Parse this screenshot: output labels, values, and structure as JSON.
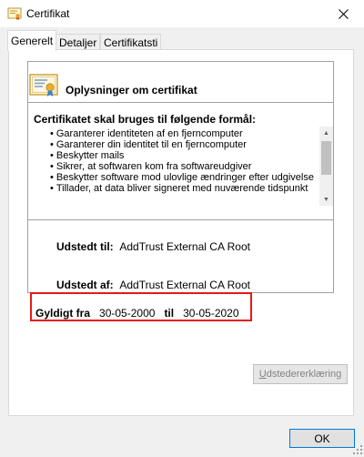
{
  "window": {
    "title": "Certifikat"
  },
  "tabs": [
    {
      "label": "Generelt",
      "active": true
    },
    {
      "label": "Detaljer",
      "active": false
    },
    {
      "label": "Certifikatsti",
      "active": false
    }
  ],
  "general": {
    "box_title": "Oplysninger om certifikat",
    "purpose_title": "Certifikatet skal bruges til følgende formål:",
    "purposes": [
      "Garanterer identiteten af en fjerncomputer",
      "Garanterer din identitet til en fjerncomputer",
      "Beskytter mails",
      "Sikrer, at softwaren kom fra softwareudgiver",
      "Beskytter software mod ulovlige ændringer efter udgivelse",
      "Tillader, at data bliver signeret med nuværende tidspunkt"
    ],
    "issued_to_label": "Udstedt til:",
    "issued_to_value": "AddTrust External CA Root",
    "issued_by_label": "Udstedt af:",
    "issued_by_value": "AddTrust External CA Root",
    "valid_from_label": "Gyldigt fra",
    "valid_from_value": "30-05-2000",
    "valid_to_label": "til",
    "valid_to_value": "30-05-2020",
    "issuer_statement_first": "U",
    "issuer_statement_rest": "dstedererklæring"
  },
  "footer": {
    "ok_label": "OK"
  },
  "colors": {
    "highlight_border": "#e51919",
    "focus_border": "#0078d7",
    "disabled_text": "#838383"
  },
  "icons": [
    "certificate-icon",
    "close-icon",
    "scroll-up-icon",
    "scroll-down-icon",
    "resize-grip-icon"
  ]
}
